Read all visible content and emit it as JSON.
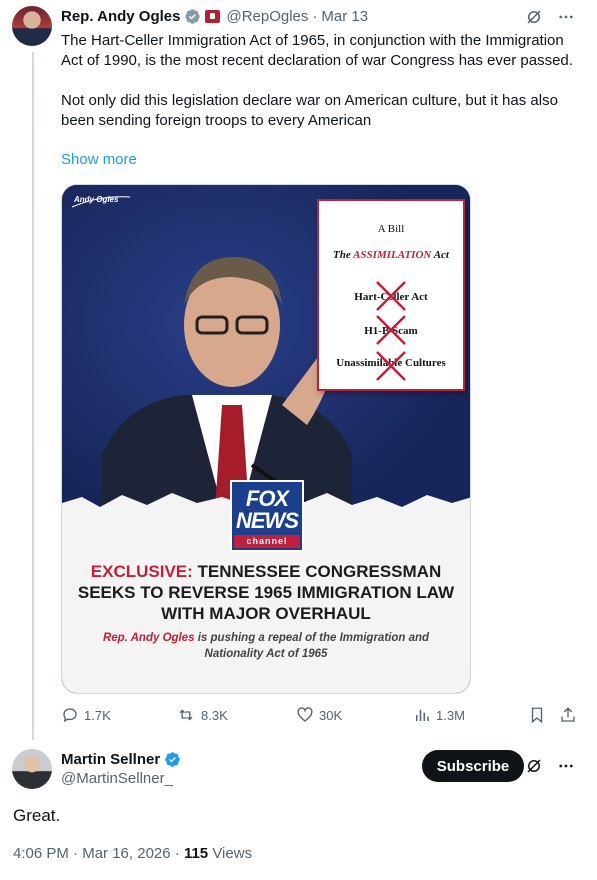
{
  "tweet": {
    "author_name": "Rep. Andy Ogles",
    "handle": "@RepOgles",
    "separator": "·",
    "date": "Mar 13",
    "text": "The Hart-Celler Immigration Act of 1965, in conjunction with the Immigration Act of 1990, is the most recent declaration of war Congress has ever passed.\n\nNot only did this legislation declare war on American culture, but it has also been sending foreign troops to every American",
    "show_more": "Show more",
    "media": {
      "brand": "Andy Ogles",
      "paper_title": "A Bill",
      "paper_act_prefix": "The",
      "paper_act_name": "ASSIMILATION",
      "paper_act_suffix": "Act",
      "paper_items": [
        "Hart-Celler Act",
        "H1-B Scam",
        "Unassimilable Cultures"
      ],
      "fox_line1": "FOX",
      "fox_line2": "NEWS",
      "fox_line3": "channel",
      "headline_red": "EXCLUSIVE:",
      "headline_rest": "TENNESSEE CONGRESSMAN SEEKS TO REVERSE 1965 IMMIGRATION LAW WITH MAJOR OVERHAUL",
      "sub_red": "Rep. Andy Ogles",
      "sub_rest": "is pushing a repeal of the Immigration and Nationality Act of 1965"
    },
    "actions": {
      "replies": "1.7K",
      "reposts": "8.3K",
      "likes": "30K",
      "views": "1.3M"
    }
  },
  "reply": {
    "author_name": "Martin Sellner",
    "handle": "@MartinSellner_",
    "subscribe_label": "Subscribe",
    "text": "Great.",
    "time": "4:06 PM",
    "date": "Mar 16, 2026",
    "views_count": "115",
    "views_label": "Views"
  },
  "colors": {
    "accent": "#1d9bf0",
    "text": "#0f1419",
    "muted": "#536471",
    "fox_red": "#c41e3a"
  }
}
